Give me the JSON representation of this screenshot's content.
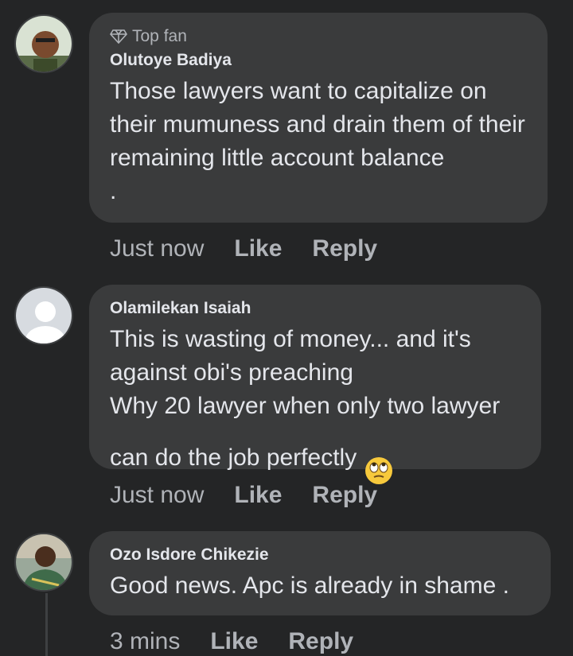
{
  "comments": [
    {
      "badge": "Top fan",
      "author": "Olutoye Badiya",
      "text": "Those lawyers want to capitalize on their mumuness and drain them of their remaining little account balance\n.",
      "time": "Just now",
      "like": "Like",
      "reply": "Reply",
      "avatar": "photo"
    },
    {
      "author": "Olamilekan Isaiah",
      "text": "This is wasting of money... and it's against obi's preaching\nWhy 20 lawyer when only two lawyer can do the job perfectly",
      "emoji": "face-with-rolling-eyes",
      "time": "Just now",
      "like": "Like",
      "reply": "Reply",
      "avatar": "default-silhouette"
    },
    {
      "author": "Ozo Isdore Chikezie",
      "text": "Good news. Apc is already in shame .",
      "time": "3 mins",
      "like": "Like",
      "reply": "Reply",
      "avatar": "photo"
    }
  ],
  "colors": {
    "background": "#242526",
    "bubble": "#3a3b3c",
    "text_primary": "#e4e6eb",
    "text_secondary": "#b0b3b8"
  }
}
